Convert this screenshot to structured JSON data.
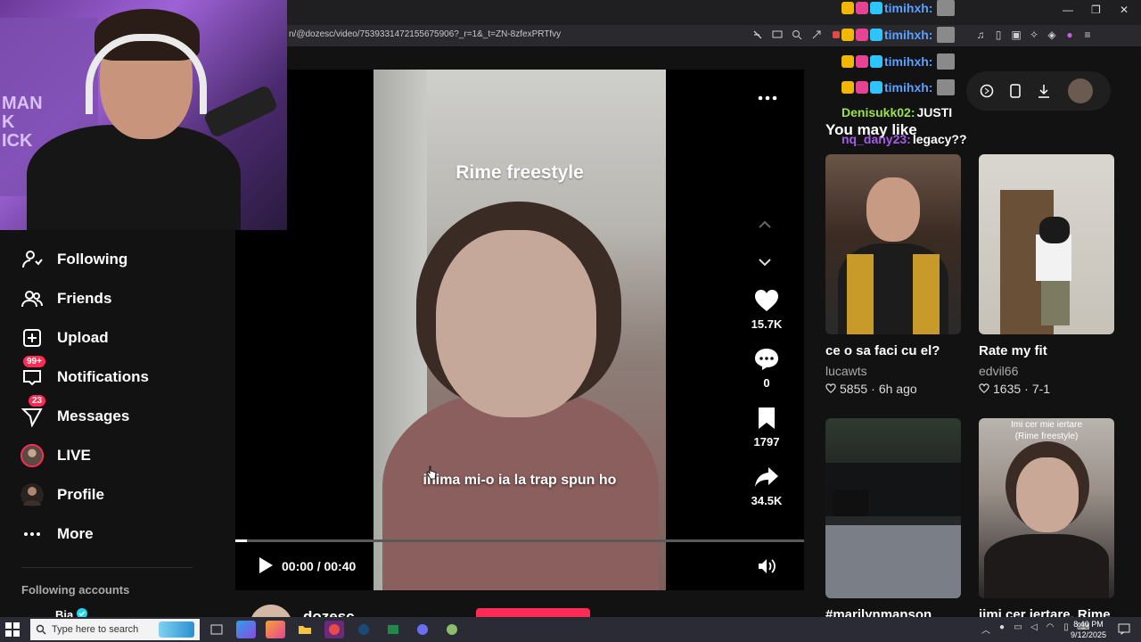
{
  "browser": {
    "url": "n/@dozesc/video/7539331472155675906?_r=1&_t=ZN-8zfexPRTfvy",
    "window_controls": [
      "—",
      "❐",
      "✕"
    ]
  },
  "sidebar": {
    "items": [
      {
        "label": "Following",
        "icon": "person-follow-icon",
        "badge": ""
      },
      {
        "label": "Friends",
        "icon": "friends-icon",
        "badge": ""
      },
      {
        "label": "Upload",
        "icon": "upload-icon",
        "badge": ""
      },
      {
        "label": "Notifications",
        "icon": "inbox-icon",
        "badge": "99+"
      },
      {
        "label": "Messages",
        "icon": "send-icon",
        "badge": "23"
      },
      {
        "label": "LIVE",
        "icon": "live-icon",
        "badge": ""
      },
      {
        "label": "Profile",
        "icon": "profile-avatar-icon",
        "badge": ""
      },
      {
        "label": "More",
        "icon": "more-icon",
        "badge": ""
      }
    ],
    "following_title": "Following accounts",
    "following_accounts": [
      {
        "name": "Bia"
      }
    ]
  },
  "video": {
    "title_overlay": "Rime freestyle",
    "caption": "inima mi-o ia la trap spun ho",
    "likes": "15.7K",
    "comments": "0",
    "saves": "1797",
    "shares": "34.5K",
    "time": "00:00 / 00:40",
    "progress": 0.02,
    "author": "dozesc"
  },
  "chat": {
    "lines": [
      {
        "user": "timihxh:",
        "text": "",
        "color": "#5aa0ff"
      },
      {
        "user": "timihxh:",
        "text": "",
        "color": "#5aa0ff"
      },
      {
        "user": "timihxh:",
        "text": "",
        "color": "#5aa0ff"
      },
      {
        "user": "timihxh:",
        "text": "",
        "color": "#5aa0ff"
      },
      {
        "user": "Denisukk02:",
        "text": "JUSTI",
        "color": "#9be24a"
      },
      {
        "user": "nq_dany23:",
        "text": "legacy??",
        "color": "#a15ce6"
      }
    ]
  },
  "recommend": {
    "title": "You may like",
    "cards": [
      {
        "title": "ce o sa faci cu el?",
        "author": "lucawts",
        "likes": "5855",
        "time": "6h ago",
        "overlay": ""
      },
      {
        "title": "Rate my fit",
        "author": "edvil66",
        "likes": "1635",
        "time": "7-1",
        "overlay": ""
      },
      {
        "title": "#marilynmanson",
        "author": "",
        "likes": "",
        "time": "",
        "overlay": ""
      },
      {
        "title": "iimi cer iertare, Rime",
        "author": "",
        "likes": "",
        "time": "",
        "overlay": "Imi cer mie iertare\n(Rime freestyle)"
      }
    ]
  },
  "webcam": {
    "poster_text": "MAN\nK\nICK"
  },
  "taskbar": {
    "search_placeholder": "Type here to search",
    "clock_time": "8:40 PM",
    "clock_date": "9/12/2025"
  },
  "colors": {
    "accent": "#fe2c55",
    "bg": "#121212"
  }
}
